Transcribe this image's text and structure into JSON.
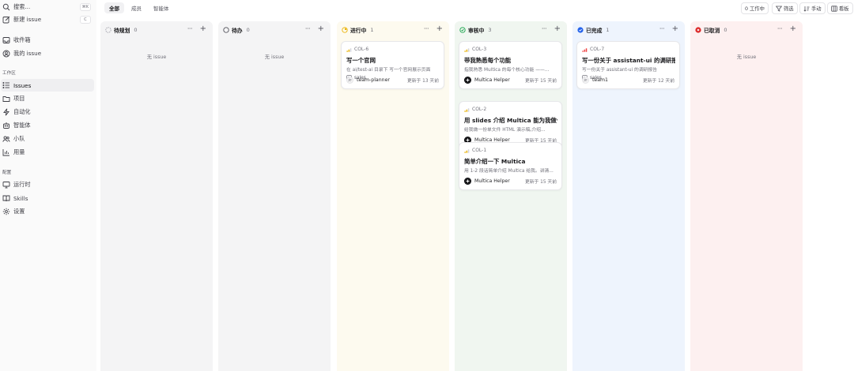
{
  "sidebar": {
    "search": {
      "label": "搜索...",
      "shortcut": "⌘K"
    },
    "new_issue": {
      "label": "新建 issue",
      "shortcut": "C"
    },
    "inbox": "收件箱",
    "my_issues": "我的 issue",
    "workspace_section": "工作区",
    "workspace_items": [
      "Issues",
      "项目",
      "自动化",
      "智能体",
      "小队",
      "用量"
    ],
    "config_section": "配置",
    "config_items": [
      "运行时",
      "Skills",
      "设置"
    ]
  },
  "topbar": {
    "tabs": [
      "全部",
      "成员",
      "智能体"
    ],
    "active_tab": "全部",
    "tools": {
      "working": "0 工作中",
      "filter": "筛选",
      "manual": "手动",
      "board": "看板"
    }
  },
  "columns": [
    {
      "name": "待规划",
      "count": "0",
      "empty_text": "无 issue",
      "color": "#a1a1aa",
      "bg": "#f4f4f5",
      "cards": []
    },
    {
      "name": "待办",
      "count": "0",
      "empty_text": "无 issue",
      "color": "#52525b",
      "bg": "#f4f4f5",
      "cards": []
    },
    {
      "name": "进行中",
      "count": "1",
      "color": "#eab308",
      "bg": "#fdfaef",
      "cards": [
        {
          "id": "COL-6",
          "priority": "medium",
          "title": "写一个官网",
          "desc": "在 ai/test-ai 目录下 写一个官网展示页面",
          "tag": "sales",
          "assignee": "team-planner",
          "assignee_type": "team",
          "updated": "更新于 13 天前"
        }
      ]
    },
    {
      "name": "审核中",
      "count": "3",
      "color": "#16a34a",
      "bg": "#f0f6f0",
      "cards": [
        {
          "id": "COL-3",
          "priority": "medium",
          "title": "带我熟悉每个功能",
          "desc": "指我熟悉 Multica 的每个核心功能 ——...",
          "tag": "",
          "assignee": "Multica Helper",
          "assignee_type": "agent",
          "updated": "更新于 15 天前"
        },
        {
          "id": "COL-2",
          "priority": "medium",
          "title": "用 slides 介绍 Multica 能为我做什么",
          "desc": "给我做一份单文件 HTML 演示稿,介绍...",
          "tag": "",
          "assignee": "Multica Helper",
          "assignee_type": "agent",
          "updated": "更新于 15 天前"
        },
        {
          "id": "COL-1",
          "priority": "medium",
          "title": "简单介绍一下 Multica",
          "desc": "用 1-2 段话简单介绍 Multica 给我。讲清...",
          "tag": "",
          "assignee": "Multica Helper",
          "assignee_type": "agent",
          "updated": "更新于 15 天前"
        }
      ]
    },
    {
      "name": "已完成",
      "count": "1",
      "color": "#2563eb",
      "bg": "#eef4fd",
      "cards": [
        {
          "id": "COL-7",
          "priority": "high",
          "title": "写一份关于 assistant-ui 的调研报告",
          "desc": "写一份关于 assistant-ui 的调研报告",
          "tag": "sales",
          "assignee": "team1",
          "assignee_type": "team",
          "updated": "更新于 12 天前"
        }
      ]
    },
    {
      "name": "已取消",
      "count": "0",
      "empty_text": "无 issue",
      "color": "#dc2626",
      "bg": "#fdf0f0",
      "cards": []
    }
  ],
  "colors": {
    "priority_medium": "#eab308",
    "priority_high": "#ef4444",
    "agent_avatar": "#18181b"
  }
}
